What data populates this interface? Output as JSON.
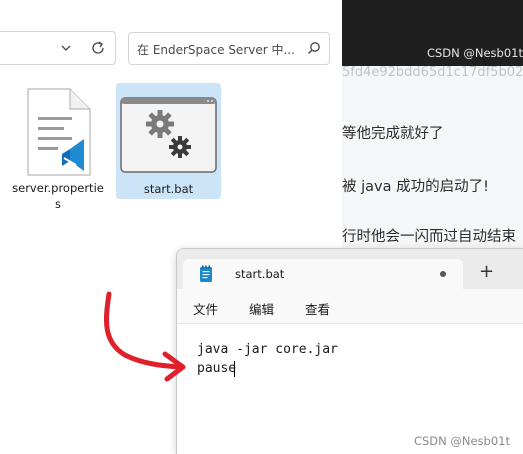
{
  "explorer": {
    "search_placeholder": "在 EnderSpace Server 中...",
    "files": [
      {
        "name": "server.properties",
        "icon": "vscode-properties-file-icon"
      },
      {
        "name": "start.bat",
        "icon": "batch-file-gear-icon",
        "selected": true
      }
    ]
  },
  "article": {
    "watermark_top": "CSDN @Nesb01t",
    "hash_fragment": "5fd4e92bdd65d1c17df5b02",
    "lines": [
      "等他完成就好了",
      "被 java 成功的启动了!",
      "行时他会一闪而过自动结束"
    ]
  },
  "notepad": {
    "tab_title": "start.bat",
    "new_tab_label": "+",
    "menus": [
      "文件",
      "编辑",
      "查看"
    ],
    "content_lines": [
      "java -jar core.jar",
      "pause"
    ],
    "watermark": "CSDN @Nesb01t"
  },
  "colors": {
    "selection": "#cce4f7",
    "annotation_arrow": "#e0202a",
    "dark_band": "#1f1f1f"
  }
}
